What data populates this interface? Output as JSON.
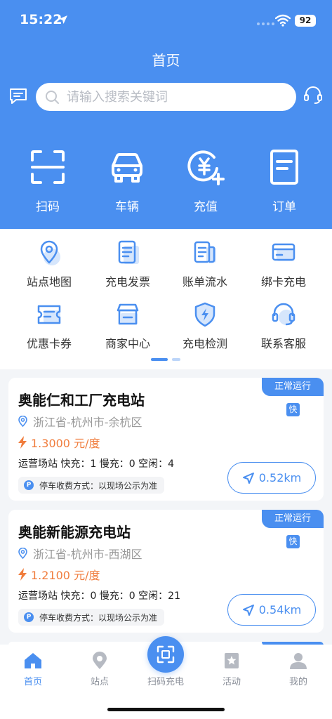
{
  "status_bar": {
    "time": "15:22",
    "battery": "92"
  },
  "header": {
    "title": "首页",
    "search_placeholder": "请输入搜索关键词",
    "message_icon": "message-icon",
    "service_icon": "headset-icon"
  },
  "main_actions": [
    {
      "label": "扫码",
      "icon": "scan-icon"
    },
    {
      "label": "车辆",
      "icon": "car-icon"
    },
    {
      "label": "充值",
      "icon": "recharge-icon"
    },
    {
      "label": "订单",
      "icon": "order-icon"
    }
  ],
  "grid": [
    {
      "label": "站点地图",
      "icon": "map-pin-icon"
    },
    {
      "label": "充电发票",
      "icon": "invoice-icon"
    },
    {
      "label": "账单流水",
      "icon": "bill-icon"
    },
    {
      "label": "绑卡充电",
      "icon": "card-icon"
    },
    {
      "label": "优惠卡券",
      "icon": "coupon-icon"
    },
    {
      "label": "商家中心",
      "icon": "shop-icon"
    },
    {
      "label": "充电检测",
      "icon": "shield-bolt-icon"
    },
    {
      "label": "联系客服",
      "icon": "headset-icon"
    }
  ],
  "pager": {
    "pages": 2,
    "active": 1
  },
  "stations": [
    {
      "name": "奥能仁和工厂充电站",
      "status": "正常运行",
      "tag": "快",
      "address": "浙江省-杭州市-余杭区",
      "price": "1.3000 元/度",
      "stats": "运营场站 快充：1 慢充：0 空闲：4",
      "parking": "停车收费方式：以现场公示为准",
      "distance": "0.52km"
    },
    {
      "name": "奥能新能源充电站",
      "status": "正常运行",
      "tag": "快",
      "address": "浙江省-杭州市-西湖区",
      "price": "1.2100 元/度",
      "stats": "运营场站 快充：0 慢充：0 空闲：21",
      "parking": "停车收费方式：以现场公示为准",
      "distance": "0.54km"
    }
  ],
  "tabbar": {
    "items": [
      {
        "label": "首页",
        "icon": "home-icon",
        "active": true
      },
      {
        "label": "站点",
        "icon": "location-icon",
        "active": false
      },
      {
        "label": "扫码充电",
        "icon": "scan-icon",
        "active": false
      },
      {
        "label": "活动",
        "icon": "activity-icon",
        "active": false
      },
      {
        "label": "我的",
        "icon": "user-icon",
        "active": false
      }
    ]
  },
  "colors": {
    "primary": "#4a8ff0",
    "price": "#f07c3c",
    "background": "#f3f5f8"
  }
}
